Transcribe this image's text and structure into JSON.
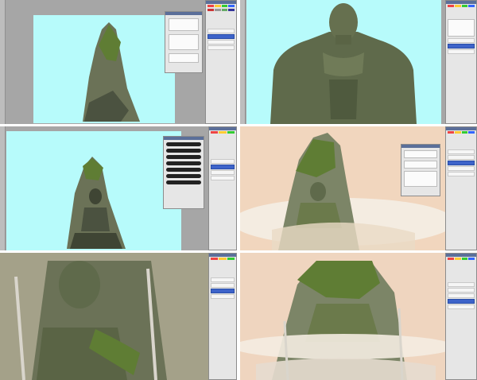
{
  "screenshot": {
    "description_panes": 6
  },
  "colors": {
    "canvas_cyan": "#b7fbfb",
    "workspace_gray": "#a9a9a9",
    "panel_gray": "#e6e6e6",
    "selection_blue": "#3d63c9",
    "rock_dark": "#4b5240",
    "rock_mid": "#7c8567",
    "moss_green": "#5f7d34",
    "skin_green": "#5f6a4b",
    "sky_peach": "#f1d6be",
    "mist": "#f4ece1"
  },
  "icons": [
    "toolbox-icon",
    "brush-preset-icon",
    "layer-visibility-icon"
  ]
}
